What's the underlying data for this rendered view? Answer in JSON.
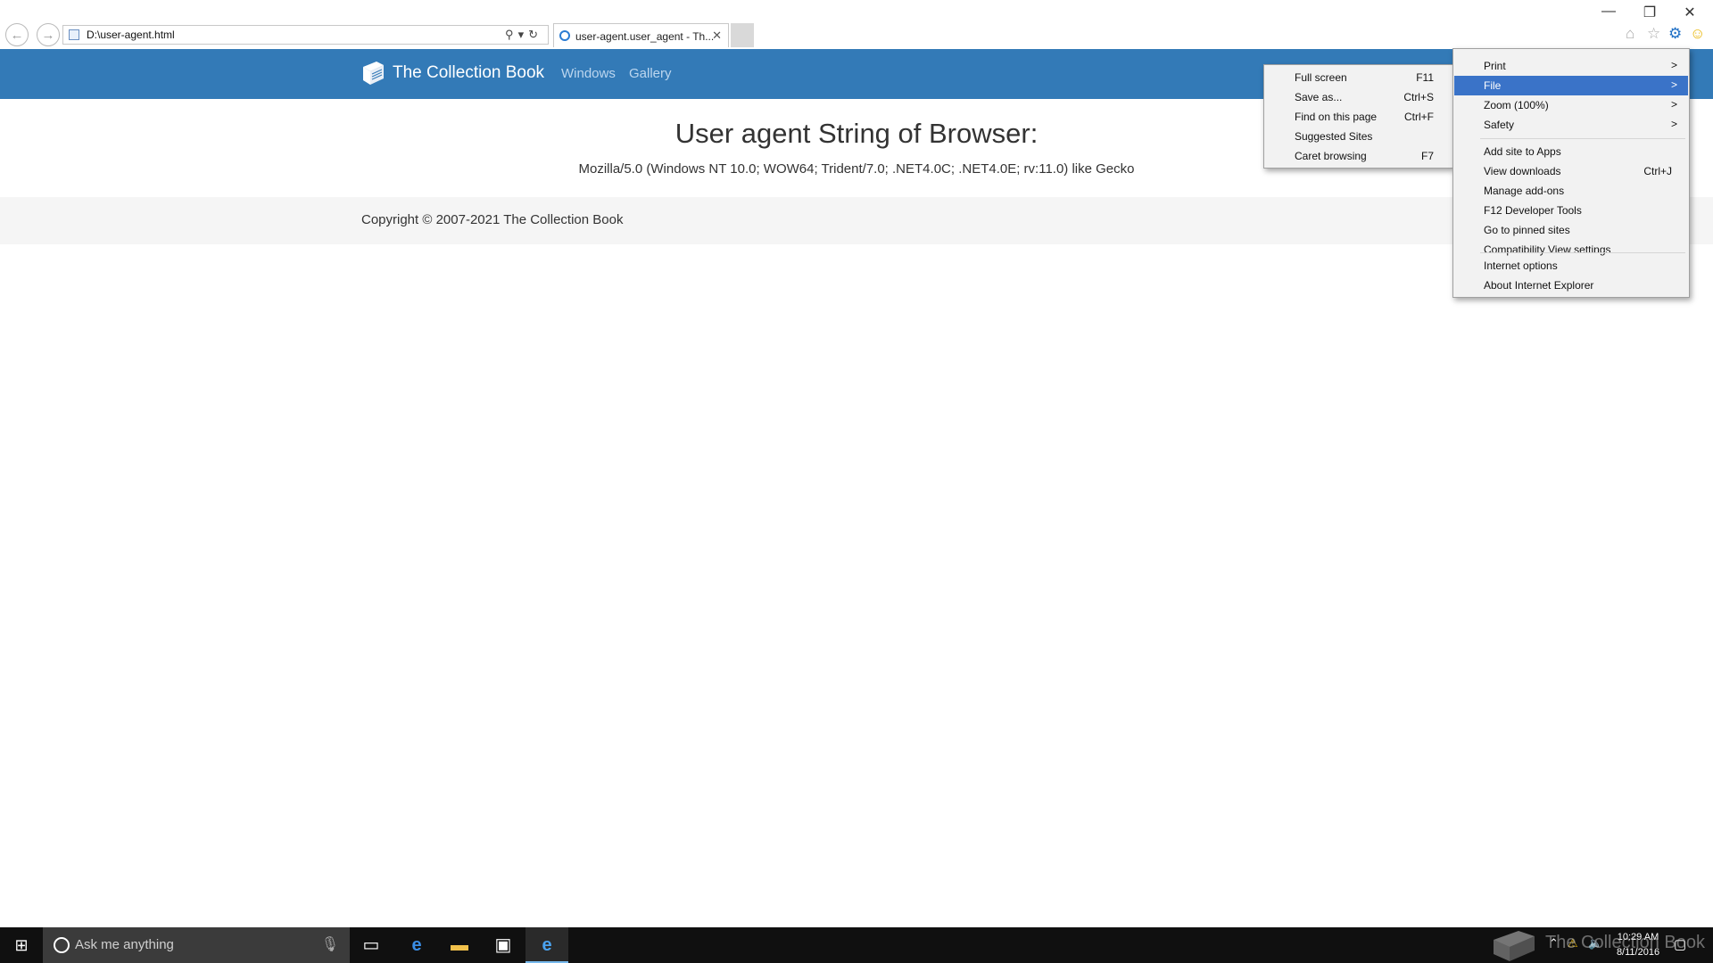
{
  "browser": {
    "address_url": "D:\\user-agent.html",
    "tab_title": "user-agent.user_agent - Th...",
    "tab_close": "✕",
    "nav_back": "←",
    "nav_forward": "→",
    "window_controls": {
      "minimize": "—",
      "restore": "❐",
      "close": "✕"
    },
    "toolbar_icons": [
      "home-icon",
      "favorites-icon",
      "settings-gear-icon",
      "feedback-smiley-icon"
    ]
  },
  "site": {
    "brand": "The Collection Book",
    "nav_links": [
      "Windows",
      "Gallery"
    ],
    "heading": "User agent String of Browser:",
    "user_agent": "Mozilla/5.0 (Windows NT 10.0; WOW64; Trident/7.0; .NET4.0C; .NET4.0E; rv:11.0) like Gecko",
    "copyright": "Copyright © 2007-2021 The Collection Book",
    "colors": {
      "navbar": "#337ab7",
      "footer": "#f5f5f5"
    }
  },
  "tools_menu": {
    "items": [
      {
        "label": "Print",
        "arrow": ">"
      },
      {
        "label": "File",
        "arrow": ">",
        "highlighted": true
      },
      {
        "label": "Zoom (100%)",
        "arrow": ">"
      },
      {
        "label": "Safety",
        "arrow": ">"
      },
      {
        "label": "Add site to Apps"
      },
      {
        "label": "View downloads",
        "shortcut": "Ctrl+J"
      },
      {
        "label": "Manage add-ons"
      },
      {
        "label": "F12 Developer Tools"
      },
      {
        "label": "Go to pinned sites"
      },
      {
        "label": "Compatibility View settings"
      },
      {
        "label": "Internet options"
      },
      {
        "label": "About Internet Explorer"
      }
    ]
  },
  "file_submenu": {
    "items": [
      {
        "label": "Full screen",
        "shortcut": "F11"
      },
      {
        "label": "Save as...",
        "shortcut": "Ctrl+S"
      },
      {
        "label": "Find on this page",
        "shortcut": "Ctrl+F"
      },
      {
        "label": "Suggested Sites",
        "shortcut": ""
      },
      {
        "label": "Caret browsing",
        "shortcut": "F7"
      }
    ],
    "highlight_color": "#3a73c8"
  },
  "taskbar": {
    "search_placeholder": "Ask me anything",
    "apps": [
      "task-view-icon",
      "edge-icon",
      "file-explorer-icon",
      "store-icon",
      "internet-explorer-icon"
    ],
    "clock_time": "10:29 AM",
    "clock_date": "8/11/2016",
    "watermark": "The Collection Book"
  }
}
